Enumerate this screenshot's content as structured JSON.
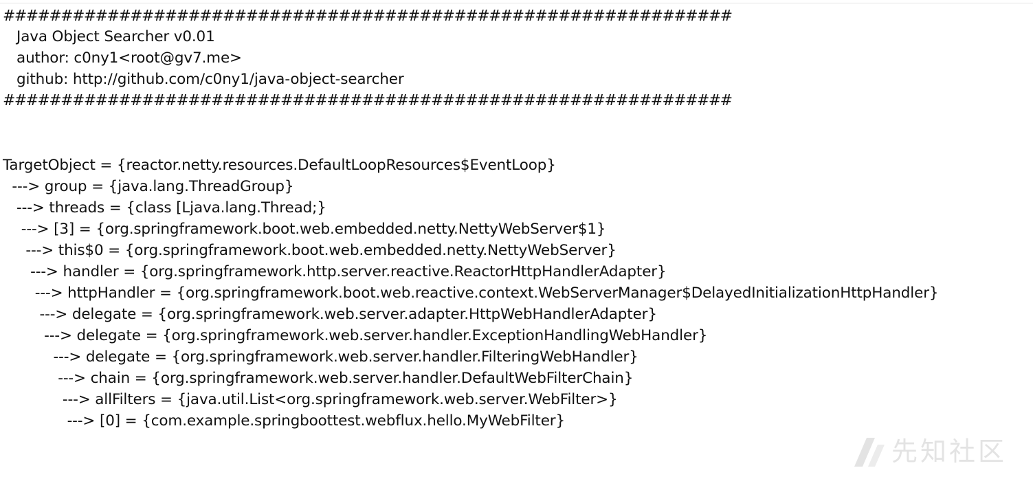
{
  "banner": {
    "rule_top": "###############################################################",
    "name": "   Java Object Searcher v0.01",
    "author": "   author: c0ny1<root@gv7.me>",
    "github": "   github: http://github.com/c0ny1/java-object-searcher",
    "rule_bottom": "###############################################################"
  },
  "result": {
    "target": "TargetObject = {reactor.netty.resources.DefaultLoopResources$EventLoop}",
    "chain": [
      "  ---> group = {java.lang.ThreadGroup}",
      "   ---> threads = {class [Ljava.lang.Thread;}",
      "    ---> [3] = {org.springframework.boot.web.embedded.netty.NettyWebServer$1}",
      "     ---> this$0 = {org.springframework.boot.web.embedded.netty.NettyWebServer}",
      "      ---> handler = {org.springframework.http.server.reactive.ReactorHttpHandlerAdapter}",
      "       ---> httpHandler = {org.springframework.boot.web.reactive.context.WebServerManager$DelayedInitializationHttpHandler}",
      "        ---> delegate = {org.springframework.web.server.adapter.HttpWebHandlerAdapter}",
      "         ---> delegate = {org.springframework.web.server.handler.ExceptionHandlingWebHandler}",
      "           ---> delegate = {org.springframework.web.server.handler.FilteringWebHandler}",
      "            ---> chain = {org.springframework.web.server.handler.DefaultWebFilterChain}",
      "             ---> allFilters = {java.util.List<org.springframework.web.server.WebFilter>}",
      "              ---> [0] = {com.example.springboottest.webflux.hello.MyWebFilter}"
    ]
  },
  "watermark": {
    "text": "先知社区",
    "icon": "xianzhi-logo-icon"
  },
  "colors": {
    "text": "#111111",
    "background": "#ffffff",
    "watermark": "#6a6a6a"
  }
}
